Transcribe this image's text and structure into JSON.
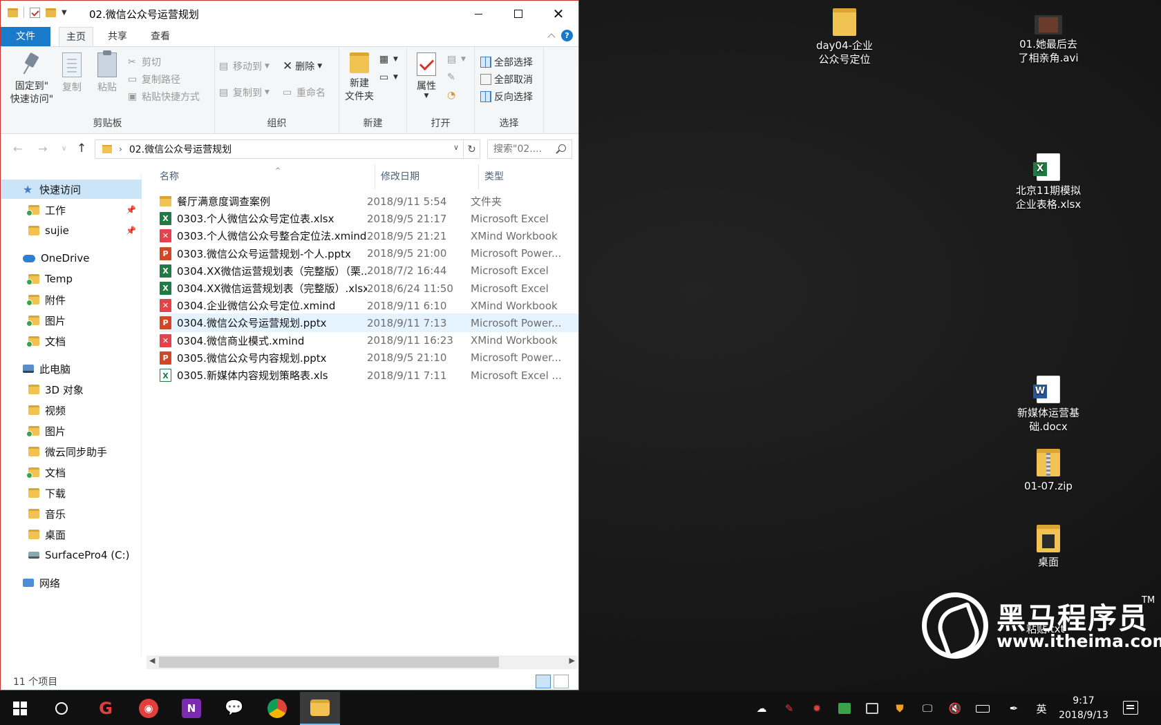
{
  "window": {
    "title": "02.微信公众号运营规划",
    "controls": {
      "minimize": "",
      "maximize": "",
      "close": "✕"
    }
  },
  "ribbon": {
    "tabs": [
      {
        "label": "文件"
      },
      {
        "label": "主页"
      },
      {
        "label": "共享"
      },
      {
        "label": "查看"
      }
    ],
    "clipboard": {
      "group_label": "剪贴板",
      "pin_label_1": "固定到\"",
      "pin_label_2": "快速访问\"",
      "copy": "复制",
      "paste": "粘贴",
      "cut": "剪切",
      "copy_path": "复制路径",
      "paste_shortcut": "粘贴快捷方式"
    },
    "organize": {
      "group_label": "组织",
      "move_to": "移动到",
      "copy_to": "复制到",
      "delete": "删除",
      "rename": "重命名"
    },
    "new": {
      "group_label": "新建",
      "new_folder_1": "新建",
      "new_folder_2": "文件夹"
    },
    "open": {
      "group_label": "打开",
      "properties": "属性"
    },
    "select": {
      "group_label": "选择",
      "select_all": "全部选择",
      "select_none": "全部取消",
      "invert": "反向选择"
    }
  },
  "address": {
    "path": "02.微信公众号运营规划",
    "search_placeholder": "搜索\"02...."
  },
  "navpane": {
    "quick_access": "快速访问",
    "pinned": [
      {
        "label": "工作"
      },
      {
        "label": "sujie"
      }
    ],
    "onedrive": "OneDrive",
    "onedrive_items": [
      {
        "label": "Temp"
      },
      {
        "label": "附件"
      },
      {
        "label": "图片"
      },
      {
        "label": "文档"
      }
    ],
    "this_pc": "此电脑",
    "pc_items": [
      {
        "label": "3D 对象"
      },
      {
        "label": "视频"
      },
      {
        "label": "图片"
      },
      {
        "label": "微云同步助手"
      },
      {
        "label": "文档"
      },
      {
        "label": "下载"
      },
      {
        "label": "音乐"
      },
      {
        "label": "桌面"
      },
      {
        "label": "SurfacePro4 (C:)"
      }
    ],
    "network": "网络"
  },
  "filelist": {
    "columns": {
      "name": "名称",
      "date": "修改日期",
      "type": "类型"
    },
    "files": [
      {
        "name": "餐厅满意度调查案例",
        "date": "2018/9/11 5:54",
        "type": "文件夹",
        "icon": "folder"
      },
      {
        "name": "0303.个人微信公众号定位表.xlsx",
        "date": "2018/9/5 21:17",
        "type": "Microsoft Excel",
        "icon": "xlsx"
      },
      {
        "name": "0303.个人微信公众号整合定位法.xmind",
        "date": "2018/9/5 21:21",
        "type": "XMind Workbook",
        "icon": "xmind"
      },
      {
        "name": "0303.微信公众号运营规划-个人.pptx",
        "date": "2018/9/5 21:00",
        "type": "Microsoft Power...",
        "icon": "pptx"
      },
      {
        "name": "0304.XX微信运营规划表（完整版）（栗...",
        "date": "2018/7/2 16:44",
        "type": "Microsoft Excel",
        "icon": "xlsx"
      },
      {
        "name": "0304.XX微信运营规划表（完整版）.xlsx",
        "date": "2018/6/24 11:50",
        "type": "Microsoft Excel",
        "icon": "xlsx"
      },
      {
        "name": "0304.企业微信公众号定位.xmind",
        "date": "2018/9/11 6:10",
        "type": "XMind Workbook",
        "icon": "xmind"
      },
      {
        "name": "0304.微信公众号运营规划.pptx",
        "date": "2018/9/11 7:13",
        "type": "Microsoft Power...",
        "icon": "pptx"
      },
      {
        "name": "0304.微信商业模式.xmind",
        "date": "2018/9/11 16:23",
        "type": "XMind Workbook",
        "icon": "xmind"
      },
      {
        "name": "0305.微信公众号内容规划.pptx",
        "date": "2018/9/5 21:10",
        "type": "Microsoft Power...",
        "icon": "pptx"
      },
      {
        "name": "0305.新媒体内容规划策略表.xls",
        "date": "2018/9/11 7:11",
        "type": "Microsoft Excel ...",
        "icon": "xls"
      }
    ],
    "selected_index": 7
  },
  "status": {
    "item_count": "11 个项目"
  },
  "desktop": {
    "icons": [
      {
        "line1": "day04-企业",
        "line2": "公众号定位",
        "kind": "folder"
      },
      {
        "line1": "01.她最后去",
        "line2": "了相亲角.avi",
        "kind": "video"
      },
      {
        "line1": "北京11期模拟",
        "line2": "企业表格.xlsx",
        "kind": "xlsx"
      },
      {
        "line1": "新媒体运营基",
        "line2": "础.docx",
        "kind": "docx"
      },
      {
        "line1": "01-07.zip",
        "line2": "",
        "kind": "zip"
      },
      {
        "line1": "桌面",
        "line2": "",
        "kind": "folder"
      }
    ],
    "partial_label": "粘贴.txt"
  },
  "watermark": {
    "brand": "黑马程序员",
    "tm": "TM",
    "url": "www.itheima.com"
  },
  "taskbar": {
    "ime": "英",
    "time": "9:17",
    "date": "2018/9/13",
    "apps": [
      {
        "name": "netease-music",
        "color": "#e23e3e"
      },
      {
        "name": "onenote",
        "color": "#7b2bb0"
      },
      {
        "name": "wechat",
        "color": "#2dc100"
      },
      {
        "name": "chrome",
        "color": "#e9b52d"
      }
    ]
  }
}
